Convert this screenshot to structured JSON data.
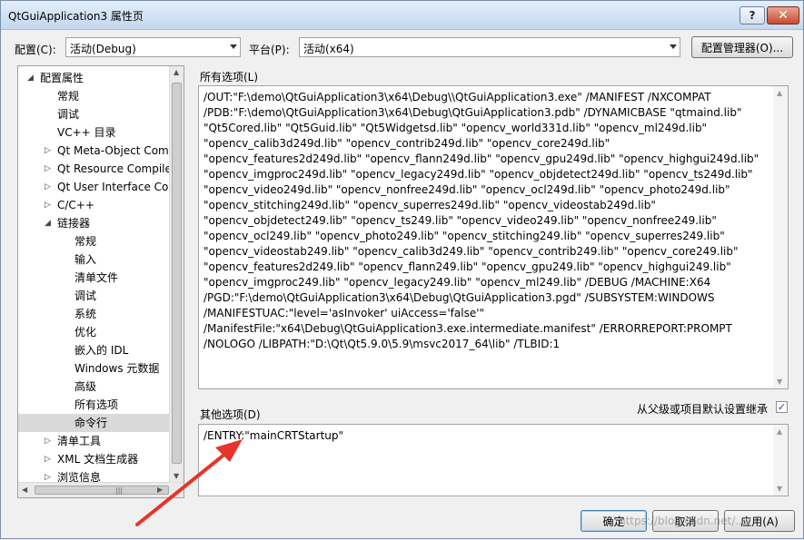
{
  "window": {
    "title": "QtGuiApplication3 属性页"
  },
  "titlebar": {
    "help_glyph": "?",
    "close_glyph": "✕"
  },
  "config": {
    "config_label": "配置(C):",
    "config_value": "活动(Debug)",
    "platform_label": "平台(P):",
    "platform_value": "活动(x64)",
    "manager_button": "配置管理器(O)..."
  },
  "tree": {
    "items": [
      {
        "label": "配置属性",
        "expander": "◢"
      },
      {
        "label": "常规"
      },
      {
        "label": "调试"
      },
      {
        "label": "VC++ 目录"
      },
      {
        "label": "Qt Meta-Object Com",
        "expander": "▷"
      },
      {
        "label": "Qt Resource Compile",
        "expander": "▷"
      },
      {
        "label": "Qt User Interface Cor",
        "expander": "▷"
      },
      {
        "label": "C/C++",
        "expander": "▷"
      },
      {
        "label": "链接器",
        "expander": "◢"
      },
      {
        "label": "常规"
      },
      {
        "label": "输入"
      },
      {
        "label": "清单文件"
      },
      {
        "label": "调试"
      },
      {
        "label": "系统"
      },
      {
        "label": "优化"
      },
      {
        "label": "嵌入的 IDL"
      },
      {
        "label": "Windows 元数据"
      },
      {
        "label": "高级"
      },
      {
        "label": "所有选项"
      },
      {
        "label": "命令行"
      },
      {
        "label": "清单工具",
        "expander": "▷"
      },
      {
        "label": "XML 文档生成器",
        "expander": "▷"
      },
      {
        "label": "浏览信息",
        "expander": "▷"
      }
    ],
    "selected_index": 19,
    "scroll_glyphs": {
      "up": "▲",
      "down": "▼",
      "left": "◀",
      "right": "▶",
      "grip": "|||"
    }
  },
  "all_options": {
    "label": "所有选项(L)",
    "text": "/OUT:\"F:\\demo\\QtGuiApplication3\\x64\\Debug\\\\QtGuiApplication3.exe\" /MANIFEST /NXCOMPAT /PDB:\"F:\\demo\\QtGuiApplication3\\x64\\Debug\\QtGuiApplication3.pdb\" /DYNAMICBASE \"qtmaind.lib\" \"Qt5Cored.lib\" \"Qt5Guid.lib\" \"Qt5Widgetsd.lib\" \"opencv_world331d.lib\" \"opencv_ml249d.lib\" \"opencv_calib3d249d.lib\" \"opencv_contrib249d.lib\" \"opencv_core249d.lib\" \"opencv_features2d249d.lib\" \"opencv_flann249d.lib\" \"opencv_gpu249d.lib\" \"opencv_highgui249d.lib\" \"opencv_imgproc249d.lib\" \"opencv_legacy249d.lib\" \"opencv_objdetect249d.lib\" \"opencv_ts249d.lib\" \"opencv_video249d.lib\" \"opencv_nonfree249d.lib\" \"opencv_ocl249d.lib\" \"opencv_photo249d.lib\" \"opencv_stitching249d.lib\" \"opencv_superres249d.lib\" \"opencv_videostab249d.lib\" \"opencv_objdetect249.lib\" \"opencv_ts249.lib\" \"opencv_video249.lib\" \"opencv_nonfree249.lib\" \"opencv_ocl249.lib\" \"opencv_photo249.lib\" \"opencv_stitching249.lib\" \"opencv_superres249.lib\" \"opencv_videostab249.lib\" \"opencv_calib3d249.lib\" \"opencv_contrib249.lib\" \"opencv_core249.lib\" \"opencv_features2d249.lib\" \"opencv_flann249.lib\" \"opencv_gpu249.lib\" \"opencv_highgui249.lib\" \"opencv_imgproc249.lib\" \"opencv_legacy249.lib\" \"opencv_ml249.lib\" /DEBUG /MACHINE:X64 /PGD:\"F:\\demo\\QtGuiApplication3\\x64\\Debug\\QtGuiApplication3.pgd\" /SUBSYSTEM:WINDOWS /MANIFESTUAC:\"level='asInvoker' uiAccess='false'\" /ManifestFile:\"x64\\Debug\\QtGuiApplication3.exe.intermediate.manifest\" /ERRORREPORT:PROMPT /NOLOGO /LIBPATH:\"D:\\Qt\\Qt5.9.0\\5.9\\msvc2017_64\\lib\" /TLBID:1"
  },
  "other_options": {
    "label": "其他选项(D)",
    "value": "/ENTRY:\"mainCRTStartup\"",
    "inherit_label": "从父级或项目默认设置继承",
    "inherit_checked": "✓"
  },
  "buttons": {
    "ok": "确定",
    "cancel": "取消",
    "apply": "应用(A)"
  },
  "annotation": {
    "arrow_color": "#e8332a"
  },
  "watermark": "https://blog.csdn.net/..."
}
